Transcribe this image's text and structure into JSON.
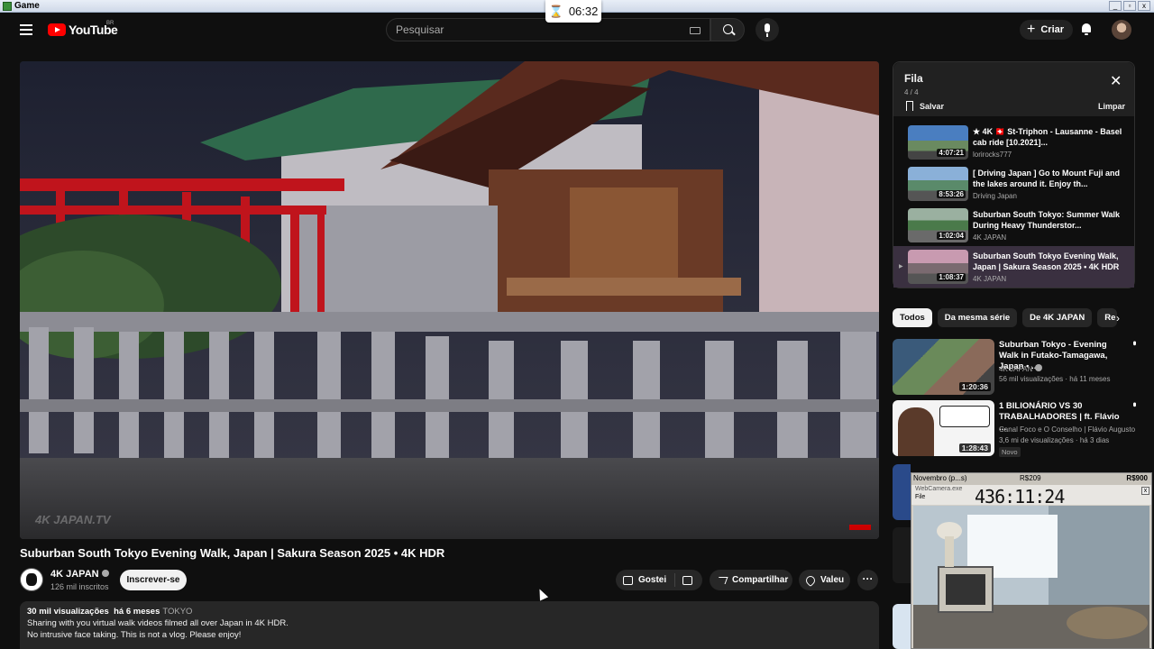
{
  "window": {
    "title": "Game",
    "controls": [
      "_",
      "▫",
      "x"
    ]
  },
  "timer": {
    "value": "06:32"
  },
  "masthead": {
    "logo": "YouTube",
    "region": "BR",
    "search_placeholder": "Pesquisar",
    "create_label": "Criar"
  },
  "player": {
    "watermark": "4K JAPAN.TV"
  },
  "video": {
    "title": "Suburban South Tokyo Evening Walk, Japan | Sakura Season 2025 • 4K HDR",
    "channel": "4K JAPAN",
    "subscribers": "126 mil inscritos",
    "subscribe_label": "Inscrever-se",
    "like_label": "Gostei",
    "share_label": "Compartilhar",
    "thanks_label": "Valeu",
    "more_label": "···"
  },
  "description": {
    "views": "30 mil visualizações",
    "date": "há 6 meses",
    "tag": "TOKYO",
    "line1": "Sharing with you virtual walk videos filmed all over Japan in 4K HDR.",
    "line2": "No intrusive face taking. This is not a vlog. Please enjoy!"
  },
  "queue": {
    "title": "Fila",
    "count": "4 / 4",
    "save_label": "Salvar",
    "clear_label": "Limpar",
    "items": [
      {
        "title": "★ 4K 🇨🇭 St-Triphon - Lausanne - Basel cab ride [10.2021]...",
        "channel": "lorirocks777",
        "duration": "4:07:21"
      },
      {
        "title": "[ Driving Japan ] Go to Mount Fuji and the lakes around it. Enjoy th...",
        "channel": "Driving Japan",
        "duration": "8:53:26"
      },
      {
        "title": "Suburban South Tokyo: Summer Walk During Heavy Thunderstor...",
        "channel": "4K JAPAN",
        "duration": "1:02:04"
      },
      {
        "title": "Suburban South Tokyo Evening Walk, Japan | Sakura Season 2025 • 4K HDR",
        "channel": "4K JAPAN",
        "duration": "1:08:37"
      }
    ]
  },
  "chips": [
    "Todos",
    "Da mesma série",
    "De 4K JAPAN",
    "Re"
  ],
  "recommendations": [
    {
      "title": "Suburban Tokyo - Evening Walk in Futako-Tamagawa, Japan • ...",
      "channel": "4K JAPAN",
      "views": "56 mil visualizações · há 11 meses",
      "duration": "1:20:36"
    },
    {
      "title": "1 BILIONÁRIO VS 30 TRABALHADORES | ft. Flávio ...",
      "channel": "Canal Foco e O Conselho | Flávio Augusto",
      "views": "3,6 mi de visualizações · há 3 dias",
      "duration": "1:28:43",
      "badge": "Novo"
    }
  ],
  "overlay_cam": {
    "month": "Novembro (p...s)",
    "price1": "R$209",
    "price2": "R$900",
    "filename": "WebCamera.exe",
    "menu": "File",
    "clock": "436:11:24"
  }
}
